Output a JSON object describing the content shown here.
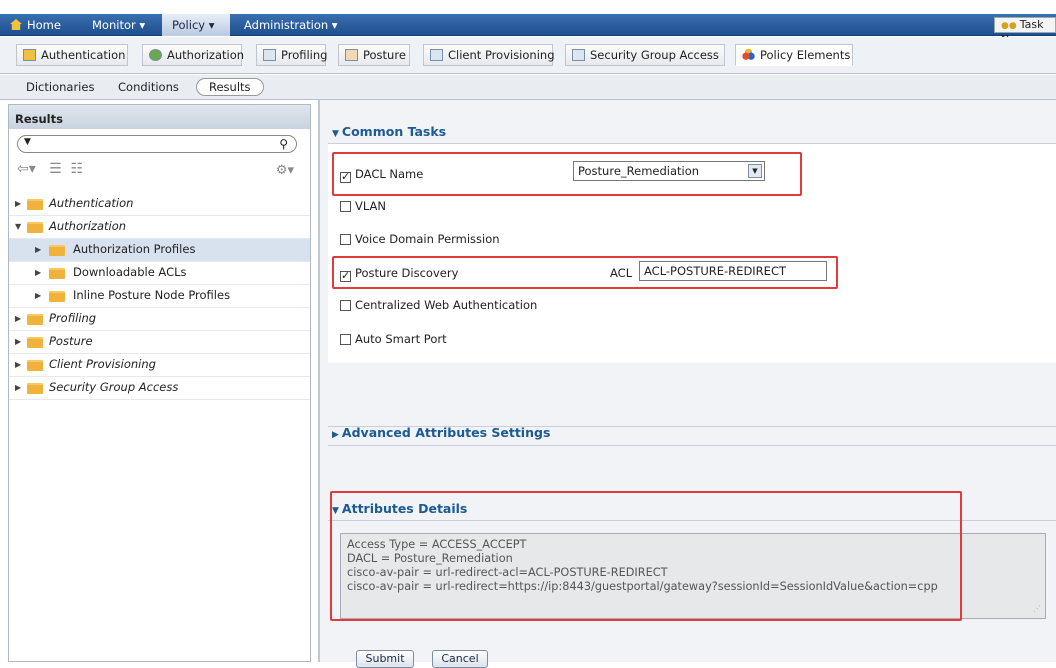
{
  "topnav": {
    "home": "Home",
    "monitor": "Monitor ▾",
    "policy": "Policy ▾",
    "administration": "Administration ▾",
    "task_nav": "Task N"
  },
  "tabs": [
    {
      "label": "Authentication"
    },
    {
      "label": "Authorization"
    },
    {
      "label": "Profiling"
    },
    {
      "label": "Posture"
    },
    {
      "label": "Client Provisioning"
    },
    {
      "label": "Security Group Access"
    },
    {
      "label": "Policy Elements"
    }
  ],
  "subnav": {
    "dictionaries": "Dictionaries",
    "conditions": "Conditions",
    "results": "Results"
  },
  "left": {
    "title": "Results",
    "tree": [
      {
        "label": "Authentication"
      },
      {
        "label": "Authorization"
      },
      {
        "label": "Authorization Profiles"
      },
      {
        "label": "Downloadable ACLs"
      },
      {
        "label": "Inline Posture Node Profiles"
      },
      {
        "label": "Profiling"
      },
      {
        "label": "Posture"
      },
      {
        "label": "Client Provisioning"
      },
      {
        "label": "Security Group Access"
      }
    ]
  },
  "main": {
    "common_tasks": "Common Tasks",
    "rows": {
      "dacl": "DACL Name",
      "vlan": "VLAN",
      "voice": "Voice Domain Permission",
      "posture": "Posture Discovery",
      "cwa": "Centralized Web Authentication",
      "asp": "Auto Smart Port"
    },
    "dacl_value": "Posture_Remediation",
    "acl_label": "ACL",
    "acl_value": "ACL-POSTURE-REDIRECT",
    "advanced": "Advanced Attributes Settings",
    "attributes": "Attributes Details",
    "attr_lines": [
      "Access Type = ACCESS_ACCEPT",
      "DACL = Posture_Remediation",
      "cisco-av-pair = url-redirect-acl=ACL-POSTURE-REDIRECT",
      "cisco-av-pair = url-redirect=https://ip:8443/guestportal/gateway?sessionId=SessionIdValue&action=cpp"
    ],
    "submit": "Submit",
    "cancel": "Cancel"
  }
}
